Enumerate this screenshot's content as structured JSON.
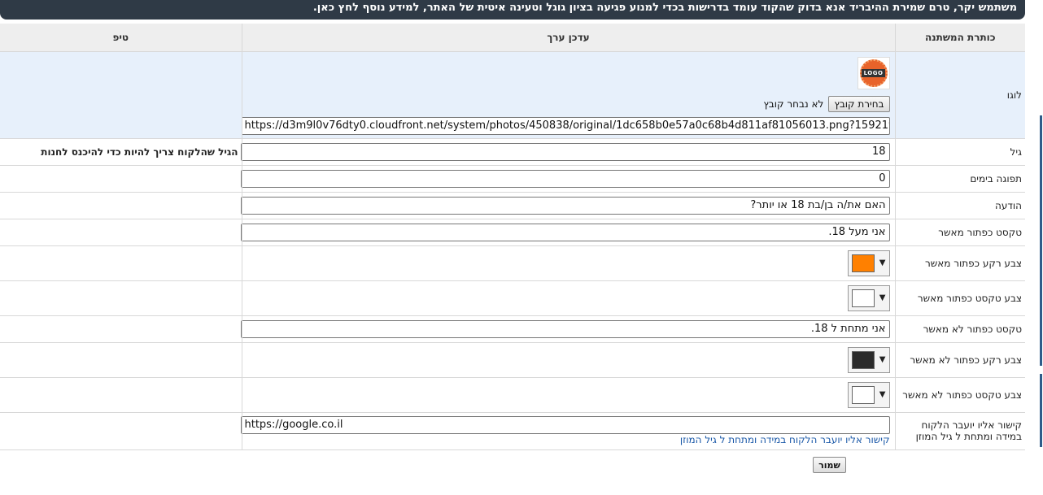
{
  "notice": "משתמש יקר, טרם שמירת ההיבריד אנא בדוק שהקוד עומד בדרישות בכדי למנוע פגיעה בציון גוגל וטעינה איטית של האתר, למידע נוסף לחץ כאן.",
  "headers": {
    "name": "כותרת המשתנה",
    "value": "עדכן ערך",
    "tip": "טיפ"
  },
  "logo_row": {
    "name": "לוגו",
    "logo_text": "LOGO",
    "file_button": "בחירת קובץ",
    "file_status": "לא נבחר קובץ",
    "url": "https://d3m9l0v76dty0.cloudfront.net/system/photos/450838/original/1dc658b0e57a0c68b4d811af81056013.png?1592198902"
  },
  "age_row": {
    "name": "גיל",
    "value": "18",
    "tip": "הגיל שהלקוח צריך להיות כדי להיכנס לחנות"
  },
  "expiry_row": {
    "name": "תפוגה בימים",
    "value": "0"
  },
  "message_row": {
    "name": "הודעה",
    "value": "האם את/ה בן/בת 18 או יותר?"
  },
  "confirm_text_row": {
    "name": "טקסט כפתור מאשר",
    "value": "אני מעל 18."
  },
  "confirm_bg_row": {
    "name": "צבע רקע כפתור מאשר",
    "color": "#ff8000"
  },
  "confirm_fg_row": {
    "name": "צבע טקסט כפתור מאשר",
    "color": "#ffffff"
  },
  "deny_text_row": {
    "name": "טקסט כפתור לא מאשר",
    "value": "אני מתחת ל 18."
  },
  "deny_bg_row": {
    "name": "צבע רקע כפתור לא מאשר",
    "color": "#2b2b2b"
  },
  "deny_fg_row": {
    "name": "צבע טקסט כפתור לא מאשר",
    "color": "#ffffff"
  },
  "redirect_row": {
    "name": "קישור אליו יועבר הלקוח במידה ומתחת ל גיל המוזן",
    "value": "https://google.co.il",
    "hint": "קישור אליו יועבר הלקוח במידה ומתחת ל גיל המוזן"
  },
  "save_label": "שמור"
}
